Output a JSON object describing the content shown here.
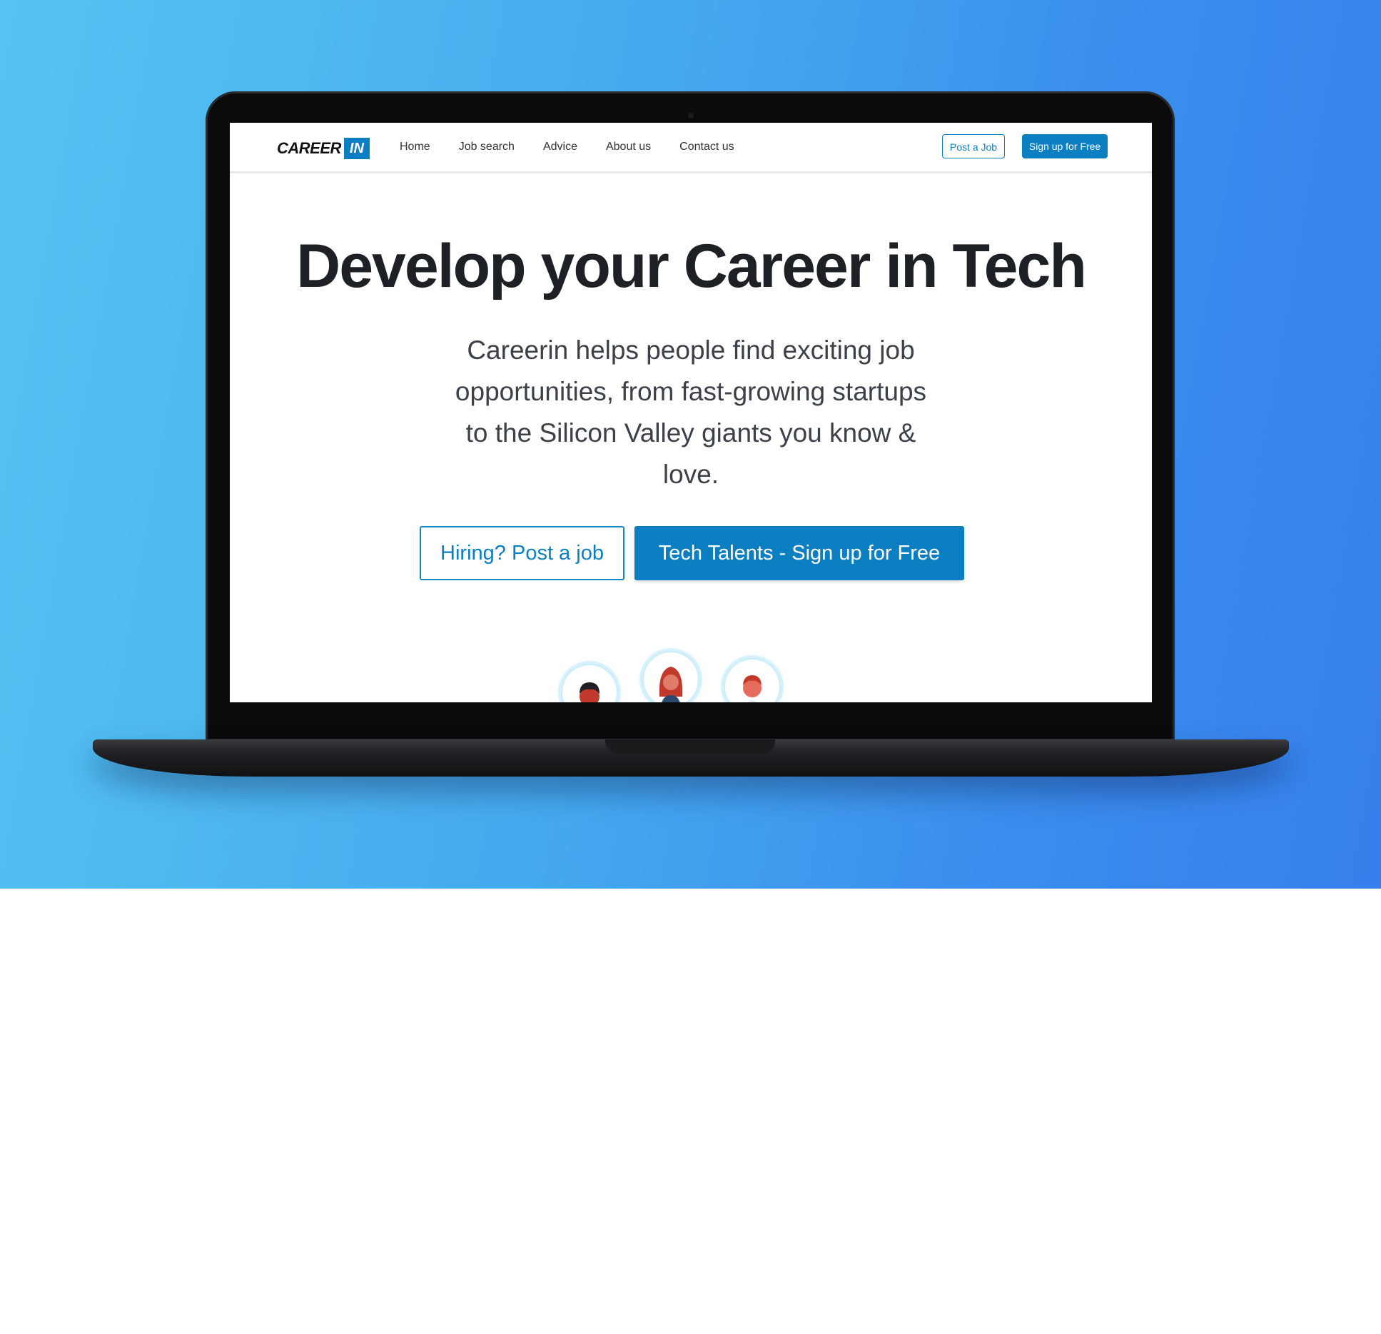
{
  "nav": {
    "logo_text": "CAREER",
    "logo_box": "IN",
    "links": [
      "Home",
      "Job search",
      "Advice",
      "About us",
      "Contact us"
    ],
    "post_job_label": "Post a Job",
    "signup_label": "Sign up for Free"
  },
  "hero": {
    "title": "Develop your Career in Tech",
    "subtitle": "Careerin helps people find exciting job opportunities, from fast-growing startups to the Silicon Valley giants you know & love.",
    "cta_hiring": "Hiring? Post a job",
    "cta_talent": "Tech Talents - Sign up for Free"
  },
  "avatars": [
    "man-dark-hair-avatar",
    "woman-red-hair-avatar",
    "man-red-hair-avatar"
  ],
  "colors": {
    "accent": "#0b7fc1",
    "title": "#1d2126",
    "gradient_start": "#55c4f2",
    "gradient_end": "#3580ec"
  }
}
